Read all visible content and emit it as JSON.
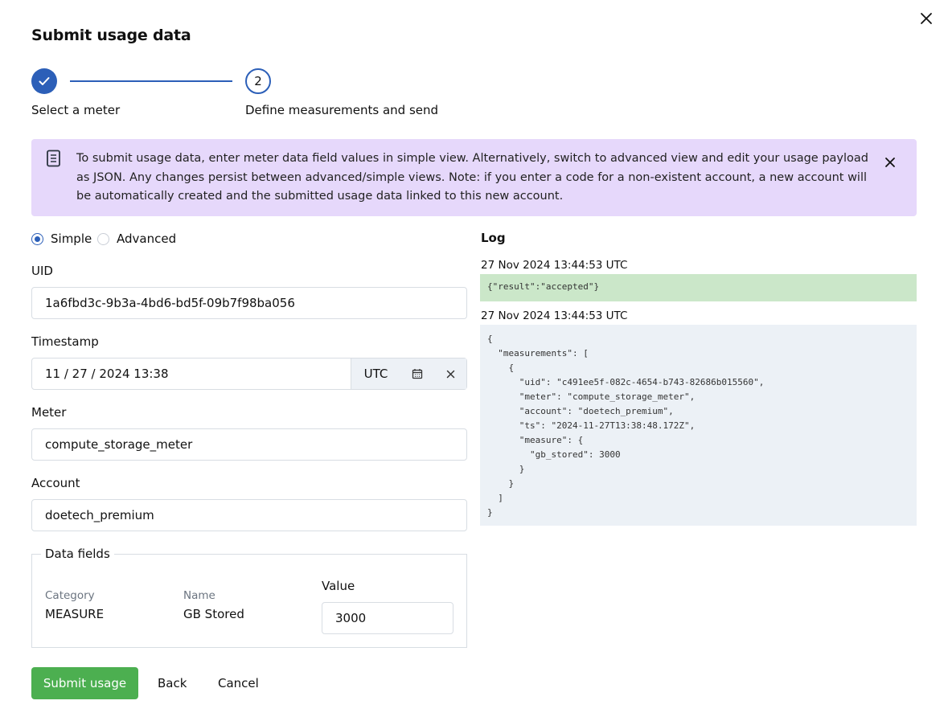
{
  "dialog": {
    "title": "Submit usage data"
  },
  "stepper": {
    "step1_label": "Select a meter",
    "step2_number": "2",
    "step2_label": "Define measurements and send",
    "accent": "#2c5fb8"
  },
  "banner": {
    "text": "To submit usage data, enter meter data field values in simple view. Alternatively, switch to advanced view and edit your usage payload as JSON. Any changes persist between advanced/simple views. Note: if you enter a code for a non-existent account, a new account will be automatically created and the submitted usage data linked to this new account.",
    "icon": "document-icon",
    "background": "#e6d8fb"
  },
  "view_toggle": {
    "simple_label": "Simple",
    "advanced_label": "Advanced",
    "selected": "Simple"
  },
  "form": {
    "uid_label": "UID",
    "uid_value": "1a6fbd3c-9b3a-4bd6-bd5f-09b7f98ba056",
    "timestamp_label": "Timestamp",
    "timestamp_value": "11 / 27 / 2024 13:38",
    "timezone": "UTC",
    "meter_label": "Meter",
    "meter_value": "compute_storage_meter",
    "account_label": "Account",
    "account_value": "doetech_premium"
  },
  "data_fields": {
    "legend": "Data fields",
    "category_header": "Category",
    "name_header": "Name",
    "value_header": "Value",
    "category": "MEASURE",
    "name": "GB Stored",
    "value": "3000"
  },
  "actions": {
    "submit_label": "Submit usage",
    "back_label": "Back",
    "cancel_label": "Cancel",
    "submit_color": "#4caf50"
  },
  "log": {
    "title": "Log",
    "entries": [
      {
        "time": "27 Nov 2024 13:44:53 UTC",
        "body": "{\"result\":\"accepted\"}",
        "background": "#cbe7c9"
      },
      {
        "time": "27 Nov 2024 13:44:53 UTC",
        "body": "{\n  \"measurements\": [\n    {\n      \"uid\": \"c491ee5f-082c-4654-b743-82686b015560\",\n      \"meter\": \"compute_storage_meter\",\n      \"account\": \"doetech_premium\",\n      \"ts\": \"2024-11-27T13:38:48.172Z\",\n      \"measure\": {\n        \"gb_stored\": 3000\n      }\n    }\n  ]\n}",
        "background": "#ecf1f6"
      }
    ]
  }
}
